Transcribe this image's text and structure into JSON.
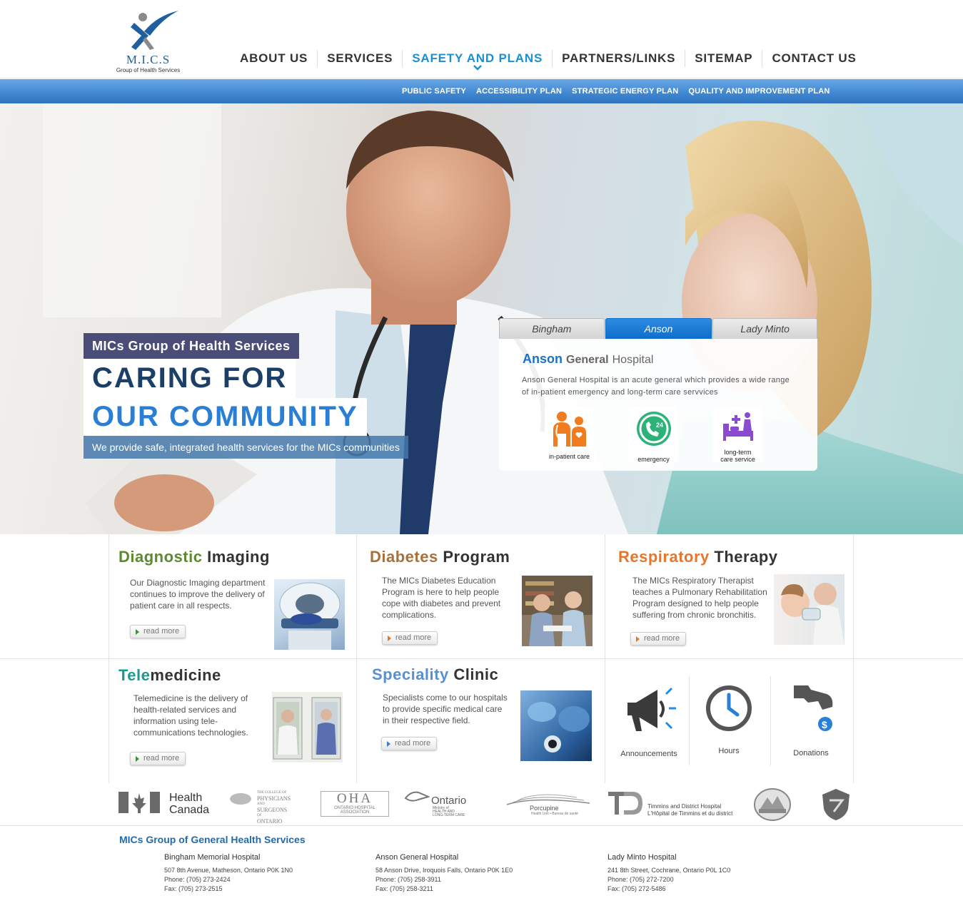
{
  "brand": {
    "logo_text": "M.I.C.S",
    "logo_subtitle": "Group of Health Services"
  },
  "main_nav": [
    {
      "label": "ABOUT US"
    },
    {
      "label": "SERVICES"
    },
    {
      "label": "SAFETY AND PLANS",
      "active": true
    },
    {
      "label": "PARTNERS/LINKS"
    },
    {
      "label": "SITEMAP"
    },
    {
      "label": "CONTACT US"
    }
  ],
  "sub_nav": [
    {
      "label": "PUBLIC SAFETY"
    },
    {
      "label": "ACCESSIBILITY PLAN"
    },
    {
      "label": "STRATEGIC ENERGY PLAN"
    },
    {
      "label": "QUALITY AND IMPROVEMENT PLAN"
    }
  ],
  "hero": {
    "badge": "MICs Group of Health Services",
    "headline_1": "CARING FOR",
    "headline_2": "OUR COMMUNITY",
    "tagline": "We provide safe, integrated health services for the MICs communities"
  },
  "hospital_tabs": {
    "tabs": [
      {
        "label": "Bingham"
      },
      {
        "label": "Anson",
        "active": true
      },
      {
        "label": "Lady Minto"
      }
    ],
    "title_a": "Anson",
    "title_b": "General",
    "title_c": "Hospital",
    "description": "Anson General Hospital is an acute general which provides a wide range of in-patient emergency and long-term care servvices",
    "services": [
      {
        "label": "in-patient care",
        "icon": "inpatient-care-icon",
        "color": "#f07c1e"
      },
      {
        "label": "emergency",
        "icon": "emergency-24-icon",
        "color": "#2db37a"
      },
      {
        "label_1": "long-term",
        "label_2": "care service",
        "icon": "long-term-care-icon",
        "color": "#8a4bd0"
      }
    ]
  },
  "services": {
    "diagnostic": {
      "title_a": "Diagnostic",
      "title_b": "Imaging",
      "color": "#5c8a2e",
      "text": "Our Diagnostic Imaging department continues to improve the delivery of patient care in all respects.",
      "read_more": "read more"
    },
    "diabetes": {
      "title_a": "Diabetes",
      "title_b": "Program",
      "color": "#a8713c",
      "text": "The MICs Diabetes Education Program is here to help people cope with diabetes and prevent complications.",
      "read_more": "read more"
    },
    "respiratory": {
      "title_a": "Respiratory",
      "title_b": "Therapy",
      "color": "#e8752a",
      "text": "The MICs Respiratory Therapist teaches a Pulmonary Rehabilitation Program designed to help people suffering from chronic bronchitis.",
      "read_more": "read more"
    },
    "telemedicine": {
      "title_a": "Tele",
      "title_b": "medicine",
      "color": "#1a9a8f",
      "text": "Telemedicine is the delivery of health-related services and information using tele-communications technologies.",
      "read_more": "read more"
    },
    "speciality": {
      "title_a": "Speciality",
      "title_b": "Clinic",
      "color": "#5a8fd0",
      "text": "Specialists come to our hospitals to provide specific medical care in their respective field.",
      "read_more": "read more"
    }
  },
  "quick_links": [
    {
      "label": "Announcements",
      "icon": "megaphone-icon"
    },
    {
      "label": "Hours",
      "icon": "clock-icon"
    },
    {
      "label": "Donations",
      "icon": "donation-hand-icon"
    }
  ],
  "partners": {
    "health_canada_1": "Health",
    "health_canada_2": "Canada",
    "cpso_1": "THE COLLEGE OF",
    "cpso_2": "PHYSICIANS",
    "cpso_3": "AND",
    "cpso_4": "SURGEONS",
    "cpso_5": "OF",
    "cpso_6": "ONTARIO",
    "oha_logo": "OHA",
    "oha_1": "ONTARIO HOSPITAL",
    "oha_2": "ASSOCIATION",
    "ontario": "Ontario",
    "ontario_sub_1": "Ministry of",
    "ontario_sub_2": "HEALTH AND",
    "ontario_sub_3": "LONG-TERM CARE",
    "porcupine": "Porcupine",
    "porcupine_sub": "Health Unit • Bureau de santé",
    "timmins_1": "Timmins and District Hospital",
    "timmins_2": "L'Hôpital de Timmins et du district"
  },
  "footer": {
    "title": "MICs Group of General Health Services",
    "hospitals": [
      {
        "name": "Bingham Memorial Hospital",
        "address": "507 8th Avenue, Matheson, Ontario   P0K 1N0",
        "phone": "Phone: (705) 273-2424",
        "fax": "Fax: (705) 273-2515"
      },
      {
        "name": "Anson General Hospital",
        "address": "58 Anson Drive, Iroquois Falls, Ontario  P0K 1E0",
        "phone": "Phone: (705) 258-3911",
        "fax": "Fax: (705) 258-3211"
      },
      {
        "name": "Lady Minto Hospital",
        "address": "241 8th Street, Cochrane, Ontario  P0L 1C0",
        "phone": "Phone: (705) 272-7200",
        "fax": "Fax: (705) 272-5486"
      }
    ]
  }
}
